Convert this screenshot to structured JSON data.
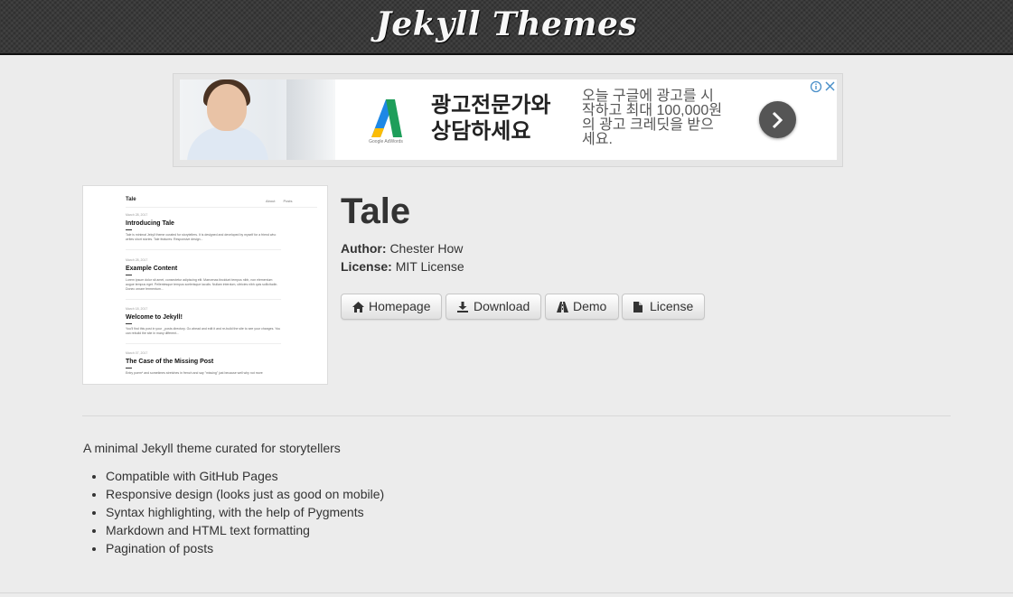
{
  "site": {
    "title": "Jekyll Themes"
  },
  "ad": {
    "logo_text": "Google AdWords",
    "headline": "광고전문가와 상담하세요",
    "body": "오늘 구글에 광고를 시작하고 최대 100,000원의 광고 크레딧을 받으세요."
  },
  "thumbnail": {
    "logo": "Tale",
    "nav": [
      "About",
      "Posts"
    ],
    "posts": [
      {
        "date": "March 28, 2017",
        "title": "Introducing Tale",
        "excerpt": "Tale is minimal Jekyll theme curated for storytellers. It is designed and developed by myself for a friend who writes short stories. Tale features: Responsive design..."
      },
      {
        "date": "March 28, 2017",
        "title": "Example Content",
        "excerpt": "Lorem ipsum dolor sit amet, consectetur adipiscing elit. Maecenas tincidunt tempus nibh, non elementum augue tempus eget. Pellentesque tempus scelerisque iaculis. Nullam interdum, ultricies nibh quis sollicitudin. Donec ornare fermentum..."
      },
      {
        "date": "March 18, 2017",
        "title": "Welcome to Jekyll!",
        "excerpt": "You'll find this post in your _posts directory. Go ahead and edit it and re-build the site to see your changes. You can rebuild the site in many different..."
      },
      {
        "date": "March 07, 2017",
        "title": "The Case of the Missing Post",
        "excerpt": "Entry poem* and sometimes stretches in french and say \"missing\" just because well why not more"
      }
    ]
  },
  "theme": {
    "name": "Tale",
    "author_label": "Author:",
    "author": "Chester How",
    "license_label": "License:",
    "license": "MIT License",
    "buttons": {
      "homepage": "Homepage",
      "download": "Download",
      "demo": "Demo",
      "license": "License"
    },
    "description": "A minimal Jekyll theme curated for storytellers",
    "features": [
      "Compatible with GitHub Pages",
      "Responsive design (looks just as good on mobile)",
      "Syntax highlighting, with the help of Pygments",
      "Markdown and HTML text formatting",
      "Pagination of posts"
    ]
  }
}
